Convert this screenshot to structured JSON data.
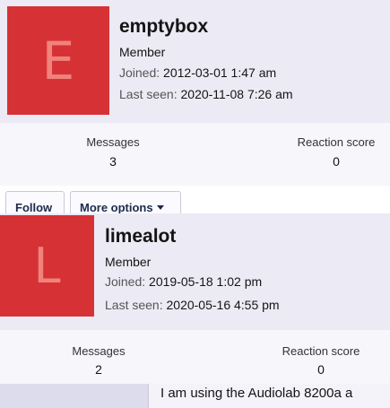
{
  "user1": {
    "avatar_letter": "E",
    "username": "emptybox",
    "role": "Member",
    "joined_label": "Joined:",
    "joined_value": "2012-03-01 1:47 am",
    "lastseen_label": "Last seen:",
    "lastseen_value": "2020-11-08 7:26 am",
    "messages_label": "Messages",
    "messages_value": "3",
    "reaction_label": "Reaction score",
    "reaction_value": "0",
    "follow_label": "Follow",
    "more_label": "More options"
  },
  "user2": {
    "avatar_letter": "L",
    "username": "limealot",
    "role": "Member",
    "joined_label": "Joined:",
    "joined_value": "2019-05-18 1:02 pm",
    "lastseen_label": "Last seen:",
    "lastseen_value": "2020-05-16 4:55 pm",
    "messages_label": "Messages",
    "messages_value": "2",
    "reaction_label": "Reaction score",
    "reaction_value": "0"
  },
  "post": {
    "text": "I am using the Audiolab 8200a a"
  },
  "colors": {
    "avatar_bg": "#d63236",
    "avatar_letter": "#f0837c",
    "card_bg": "#ecebf5"
  },
  "icons": {
    "more_options": "caret-down-icon"
  }
}
